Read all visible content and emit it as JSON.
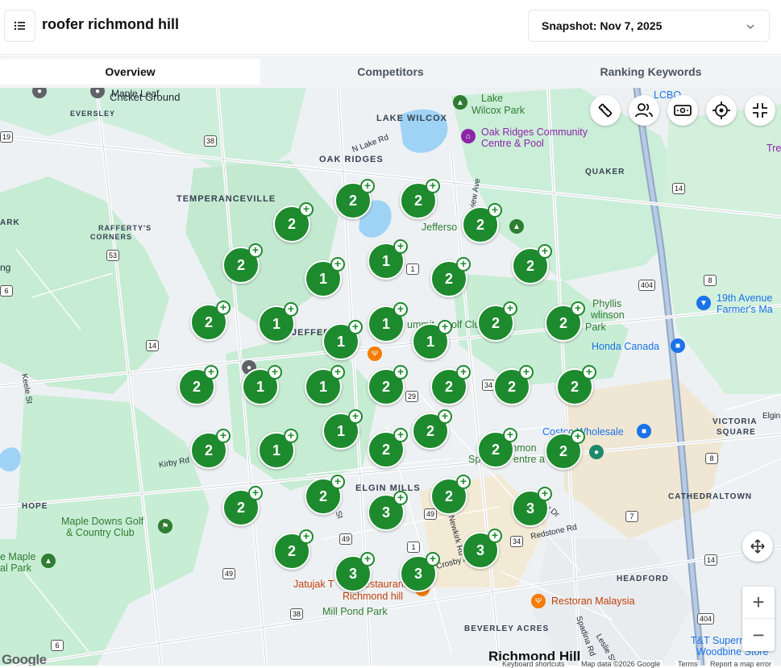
{
  "header": {
    "title": "roofer richmond hill",
    "snapshot_label": "Snapshot: Nov 7, 2025"
  },
  "tabs": [
    {
      "label": "Overview",
      "active": true
    },
    {
      "label": "Competitors",
      "active": false
    },
    {
      "label": "Ranking Keywords",
      "active": false
    }
  ],
  "map": {
    "places": {
      "maple_leaf": "Maple Leaf",
      "cricket_ground": "Cricket Ground",
      "eversley": "EVERSLEY",
      "lake_wilcox_park_1": "Lake",
      "lake_wilcox_park_2": "Wilcox Park",
      "lake_wilcox": "LAKE WILCOX",
      "lcbo": "LCBO",
      "oak_ridges_cc_1": "Oak Ridges Community",
      "oak_ridges_cc_2": "Centre & Pool",
      "n_lake_rd": "N Lake Rd",
      "oak_ridges": "OAK RIDGES",
      "bayview_ave": "Bayview Ave",
      "quaker": "QUAKER",
      "temperanceville": "TEMPERANCEVILLE",
      "ark": "ARK",
      "raffertys_1": "RAFFERTY'S",
      "raffertys_2": "CORNERS",
      "jefferson": "Jefferso",
      "ng": "ng",
      "nineteenth_1": "19th Avenue",
      "nineteenth_2": "Farmer's Ma",
      "phyllis_1": "Phyllis",
      "phyllis_2": "wlinson",
      "phyllis_3": "Park",
      "jeffer": "JEFFER",
      "summit": "ummit",
      "golf_club": "olf Clu",
      "honda": "Honda Canada",
      "keele_st": "Keele St",
      "costco": "Costco Wholesale",
      "victoria_1": "VICTORIA",
      "victoria_2": "SQUARE",
      "elgin": "Elgin",
      "kirby_rd": "Kirby Rd",
      "richmond_sc_1": "chmon",
      "richmond_sc_2": "Sp",
      "richmond_sc_3": "entre a",
      "hope": "HOPE",
      "elgin_mills": "ELGIN MILLS",
      "cathedraltown": "CATHEDRALTOWN",
      "maple_downs_1": "Maple Downs Golf",
      "maple_downs_2": "& Country Club",
      "yonge_st": "Yonge St",
      "newkirk": "Newkirk Rd",
      "redstone": "Redstone Rd",
      "bayview_dr": "y Dr",
      "maple_park_1": "e Maple",
      "maple_park_2": "al Park",
      "crosby": "Crosby A",
      "jatujak_1": "Jatujak T",
      "jatujak_2": "estaurant",
      "jatujak_3": "Richmond hill",
      "headford": "HEADFORD",
      "mill_pond": "Mill Pond Park",
      "restoran": "Restoran Malaysia",
      "beverley": "BEVERLEY ACRES",
      "richmond_hill": "Richmond Hill",
      "leslie_st": "Leslie St",
      "spadina": "Spadina Rd",
      "tt_1": "T&T Supermarket",
      "tt_2": "Woodbine Store",
      "tree": "Tre"
    },
    "shields": [
      "38",
      "53",
      "14",
      "6",
      "404",
      "8",
      "29",
      "34",
      "14",
      "49",
      "1",
      "49",
      "49",
      "34",
      "8",
      "38",
      "6",
      "404",
      "7",
      "14",
      "19",
      "1"
    ],
    "markers": [
      {
        "n": "2"
      },
      {
        "n": "2"
      },
      {
        "n": "2"
      },
      {
        "n": "2"
      },
      {
        "n": "2"
      },
      {
        "n": "1"
      },
      {
        "n": "1"
      },
      {
        "n": "2"
      },
      {
        "n": "2"
      },
      {
        "n": "2"
      },
      {
        "n": "1"
      },
      {
        "n": "1"
      },
      {
        "n": "1"
      },
      {
        "n": "1"
      },
      {
        "n": "2"
      },
      {
        "n": "2"
      },
      {
        "n": "2"
      },
      {
        "n": "1"
      },
      {
        "n": "1"
      },
      {
        "n": "2"
      },
      {
        "n": "2"
      },
      {
        "n": "2"
      },
      {
        "n": "2"
      },
      {
        "n": "2"
      },
      {
        "n": "1"
      },
      {
        "n": "1"
      },
      {
        "n": "2"
      },
      {
        "n": "2"
      },
      {
        "n": "2"
      },
      {
        "n": "2"
      },
      {
        "n": "2"
      },
      {
        "n": "3"
      },
      {
        "n": "2"
      },
      {
        "n": "3"
      },
      {
        "n": "2"
      },
      {
        "n": "3"
      },
      {
        "n": "3"
      },
      {
        "n": "3"
      }
    ],
    "footer": {
      "google": "Google",
      "shortcuts": "Keyboard shortcuts",
      "mapdata": "Map data ©2026 Google",
      "terms": "Terms",
      "report": "Report a map error"
    }
  }
}
